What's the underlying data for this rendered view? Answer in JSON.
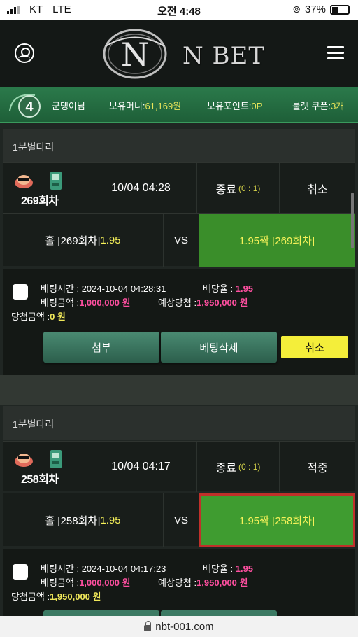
{
  "status": {
    "carrier": "KT",
    "network": "LTE",
    "time": "오전 4:48",
    "battery": "37%"
  },
  "header": {
    "brand": "N BET",
    "logo_letter": "N"
  },
  "info": {
    "level": "4",
    "username": "군댕이님",
    "money_label": "보유머니:",
    "money_value": "61,169원",
    "points_label": "보유포인트:",
    "points_value": "0P",
    "coupon_label": "룰렛 쿠폰:",
    "coupon_value": "3개"
  },
  "bets": [
    {
      "title": "1분별다리",
      "round": "269회차",
      "datetime": "10/04 04:28",
      "status_label": "종료",
      "score": "(0 : 1)",
      "result": "취소",
      "home_label": "홀 [269회차]",
      "home_odds": "1.95",
      "vs": "VS",
      "away_label": "1.95짝 [269회차]",
      "bet_time_label": "배팅시간 :",
      "bet_time": "2024-10-04 04:28:31",
      "odds_label": "배당율 :",
      "odds": "1.95",
      "amount_label": "배팅금액 :",
      "amount": "1,000,000 원",
      "expected_label": "예상당첨 :",
      "expected": "1,950,000 원",
      "win_label": "당첨금액 :",
      "win": "0 원",
      "btn_attach": "첨부",
      "btn_delete": "베팅삭제",
      "btn_cancel": "취소"
    },
    {
      "title": "1분별다리",
      "round": "258회차",
      "datetime": "10/04 04:17",
      "status_label": "종료",
      "score": "(0 : 1)",
      "result": "적중",
      "home_label": "홀 [258회차]",
      "home_odds": "1.95",
      "vs": "VS",
      "away_label": "1.95짝 [258회차]",
      "bet_time_label": "배팅시간 :",
      "bet_time": "2024-10-04 04:17:23",
      "odds_label": "배당율 :",
      "odds": "1.95",
      "amount_label": "배팅금액 :",
      "amount": "1,000,000 원",
      "expected_label": "예상당첨 :",
      "expected": "1,950,000 원",
      "win_label": "당첨금액 :",
      "win": "1,950,000 원"
    }
  ],
  "browser": {
    "url": "nbt-001.com"
  },
  "colors": {
    "accent_green": "#3a8e2a",
    "odds_yellow": "#f7f25a",
    "amount_magenta": "#ff4fa0",
    "cancel_yellow": "#f4ee3a"
  }
}
